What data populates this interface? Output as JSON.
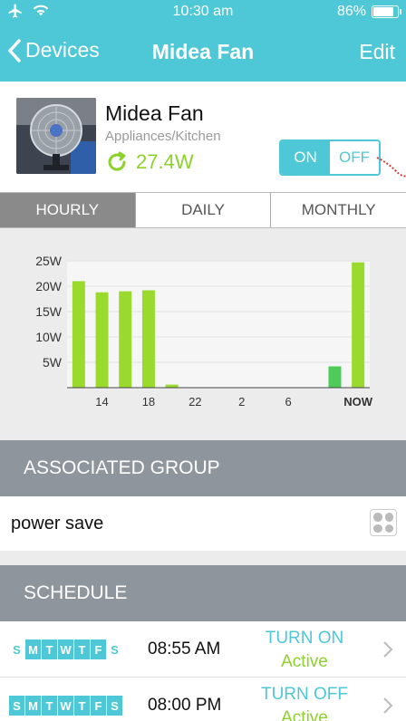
{
  "status_bar": {
    "time": "10:30 am",
    "battery": "86%",
    "battery_level": 0.86
  },
  "nav": {
    "back_label": "Devices",
    "title": "Midea Fan",
    "edit_label": "Edit"
  },
  "device": {
    "name": "Midea Fan",
    "category": "Appliances/Kitchen",
    "power": "27.4W",
    "toggle": {
      "on_label": "ON",
      "off_label": "OFF",
      "state": "on"
    }
  },
  "tabs": [
    {
      "label": "HOURLY",
      "active": true
    },
    {
      "label": "DAILY",
      "active": false
    },
    {
      "label": "MONTHLY",
      "active": false
    }
  ],
  "chart_data": {
    "type": "bar",
    "y_ticks": [
      "25W",
      "20W",
      "15W",
      "10W",
      "5W"
    ],
    "x_ticks": [
      "14",
      "18",
      "22",
      "2",
      "6",
      "NOW"
    ],
    "ylim": [
      0,
      25
    ],
    "values": [
      21,
      18.8,
      19,
      19.2,
      0.6,
      0,
      0,
      0,
      0,
      0,
      0,
      4.2,
      24.7
    ],
    "grid": true,
    "colors": {
      "bar": "#9ad92d",
      "bar_alt": "#4dcc5c",
      "axis": "#333333"
    }
  },
  "associated_group": {
    "header": "ASSOCIATED GROUP",
    "name": "power save"
  },
  "schedule": {
    "header": "SCHEDULE",
    "items": [
      {
        "days": [
          "S",
          "M",
          "T",
          "W",
          "T",
          "F",
          "S"
        ],
        "active_days": [
          false,
          true,
          true,
          true,
          true,
          true,
          false
        ],
        "time": "08:55 AM",
        "action": "TURN ON",
        "status": "Active"
      },
      {
        "days": [
          "S",
          "M",
          "T",
          "W",
          "T",
          "F",
          "S"
        ],
        "active_days": [
          true,
          true,
          true,
          true,
          true,
          true,
          true
        ],
        "time": "08:00 PM",
        "action": "TURN OFF",
        "status": "Active"
      }
    ]
  },
  "colors": {
    "accent": "#4ec8d6",
    "green": "#8dd12b",
    "section": "#8f959c"
  }
}
